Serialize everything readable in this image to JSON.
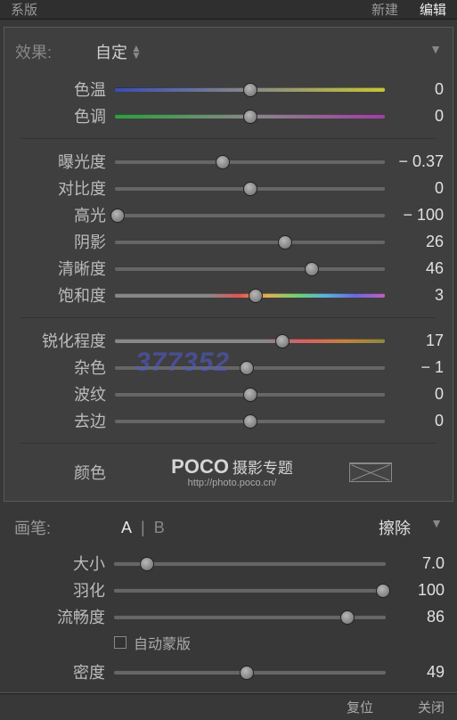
{
  "topbar": {
    "left": "系版",
    "mid": "新建",
    "right": "编辑"
  },
  "effects": {
    "title": "效果:",
    "dropdown": "自定",
    "collapse_glyph": "▼",
    "group1": [
      {
        "label": "色温",
        "value": "0",
        "pct": 50,
        "track": "temp"
      },
      {
        "label": "色调",
        "value": "0",
        "pct": 50,
        "track": "tint"
      }
    ],
    "group2": [
      {
        "label": "曝光度",
        "value": "− 0.37",
        "pct": 40,
        "track": "plain"
      },
      {
        "label": "对比度",
        "value": "0",
        "pct": 50,
        "track": "plain"
      },
      {
        "label": "高光",
        "value": "− 100",
        "pct": 1,
        "track": "plain"
      },
      {
        "label": "阴影",
        "value": "26",
        "pct": 63,
        "track": "plain"
      },
      {
        "label": "清晰度",
        "value": "46",
        "pct": 73,
        "track": "plain"
      },
      {
        "label": "饱和度",
        "value": "3",
        "pct": 52,
        "track": "saturation"
      }
    ],
    "group3": [
      {
        "label": "锐化程度",
        "value": "17",
        "pct": 62,
        "track": "sharpen"
      },
      {
        "label": "杂色",
        "value": "− 1",
        "pct": 49,
        "track": "plain"
      },
      {
        "label": "波纹",
        "value": "0",
        "pct": 50,
        "track": "plain"
      },
      {
        "label": "去边",
        "value": "0",
        "pct": 50,
        "track": "plain"
      }
    ],
    "color_label": "颜色",
    "watermark_brand": "POCO",
    "watermark_tag": "摄影专题",
    "watermark_url": "http://photo.poco.cn/"
  },
  "brush": {
    "title": "画笔:",
    "a": "A",
    "b": "B",
    "sep": "|",
    "erase": "擦除",
    "rows": [
      {
        "label": "大小",
        "value": "7.0",
        "pct": 12
      },
      {
        "label": "羽化",
        "value": "100",
        "pct": 99
      },
      {
        "label": "流畅度",
        "value": "86",
        "pct": 86
      }
    ],
    "auto_mask": "自动蒙版",
    "density": {
      "label": "密度",
      "value": "49",
      "pct": 49
    }
  },
  "footer": {
    "left": "复位",
    "right": "关闭"
  },
  "overlay_num": "377352"
}
